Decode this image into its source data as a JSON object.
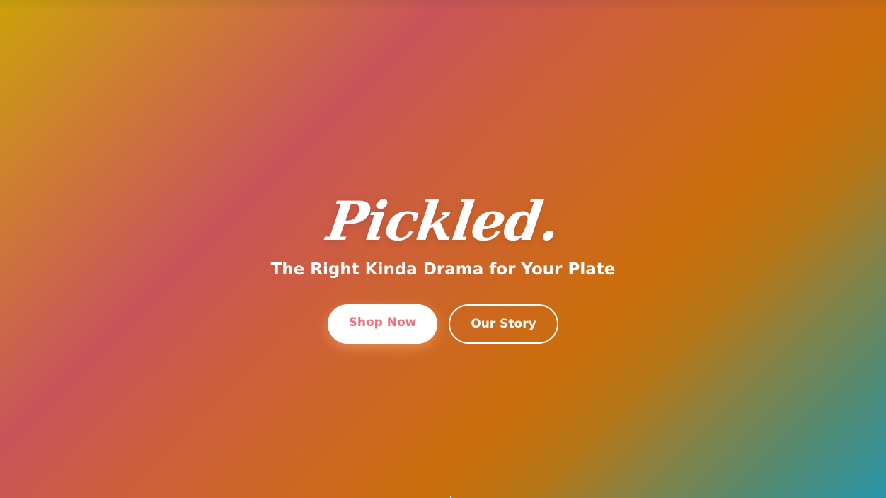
{
  "hero": {
    "brand": "Pickled.",
    "tagline": "The Right Kinda Drama for Your Plate",
    "buttons": {
      "primary_label": "Shop Now",
      "secondary_label": "Our Story"
    }
  },
  "colors": {
    "gradient_start": "#cca20a",
    "gradient_pink": "#c9545b",
    "gradient_orange": "#cc6e0d",
    "gradient_end": "#2a95a9",
    "primary_button_text": "#f0707c",
    "text": "#ffffff"
  }
}
